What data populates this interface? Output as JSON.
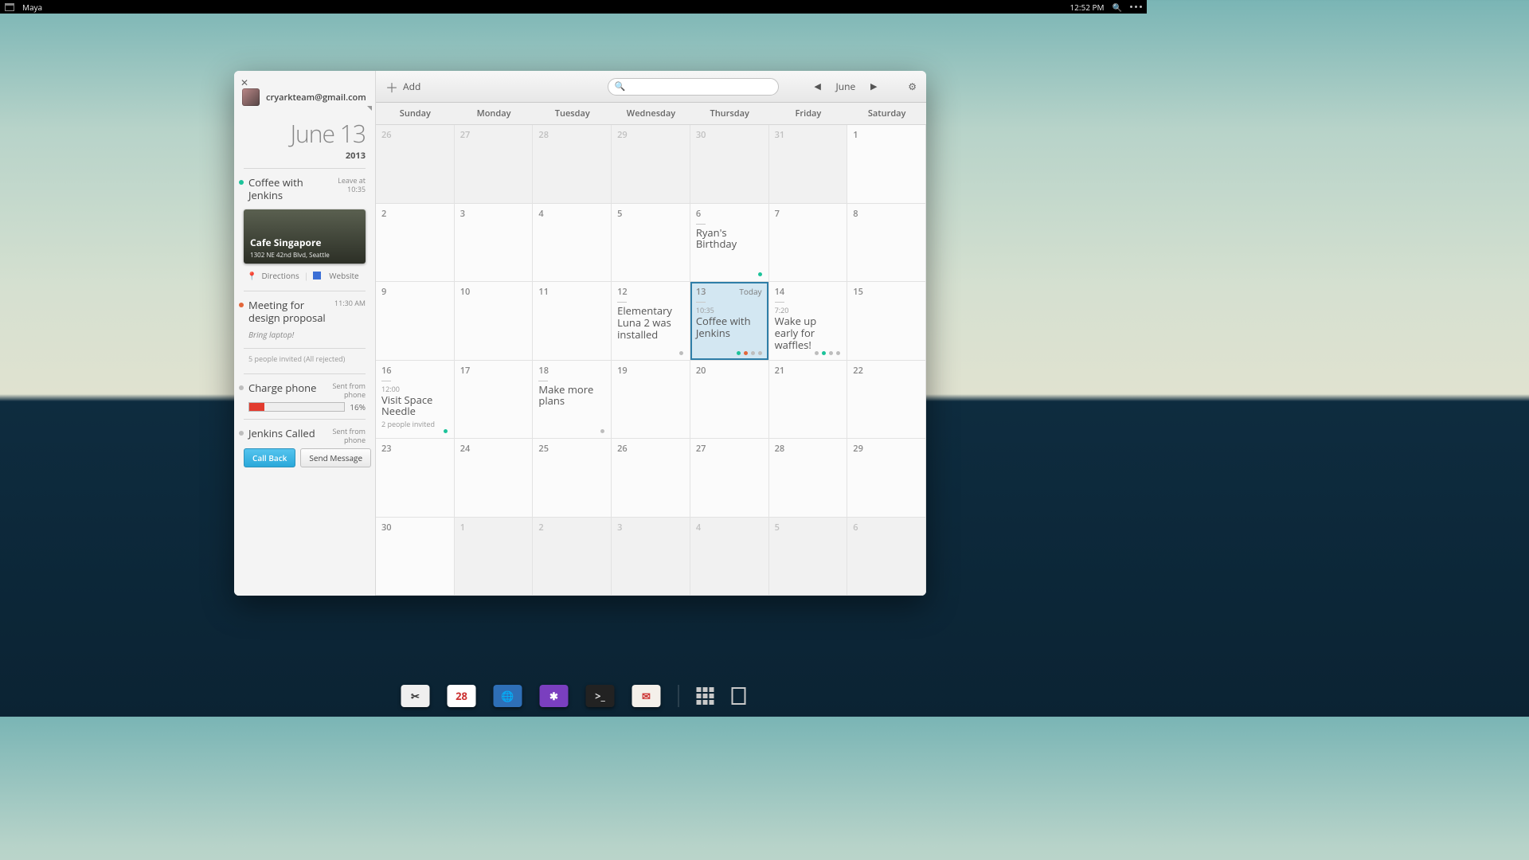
{
  "topbar": {
    "app_name": "Maya",
    "clock": "12:52 PM"
  },
  "sidebar": {
    "email": "cryarkteam@gmail.com",
    "date_title": "June 13",
    "date_year": "2013",
    "items": [
      {
        "title": "Coffee with Jenkins",
        "meta1": "Leave at",
        "meta2": "10:35",
        "dot": "#1cc39a"
      },
      {
        "title": "Meeting for design proposal",
        "meta1": "11:30 AM",
        "meta2": "",
        "dot": "#e2663a",
        "note": "Bring laptop!",
        "sub": "5 people invited (All rejected)"
      },
      {
        "title": "Charge phone",
        "meta1": "Sent from",
        "meta2": "phone",
        "dot": "#bdbdbd",
        "progress": 16,
        "pct_label": "16%"
      },
      {
        "title": "Jenkins Called",
        "meta1": "Sent from",
        "meta2": "phone",
        "dot": "#bdbdbd"
      }
    ],
    "place": {
      "name": "Cafe Singapore",
      "address": "1302 NE 42nd Blvd, Seattle"
    },
    "place_links": {
      "directions": "Directions",
      "website": "Website"
    },
    "buttons": {
      "call_back": "Call Back",
      "send_message": "Send Message"
    }
  },
  "toolbar": {
    "add_label": "Add",
    "search_placeholder": "",
    "month_label": "June"
  },
  "day_headers": [
    "Sunday",
    "Monday",
    "Tuesday",
    "Wednesday",
    "Thursday",
    "Friday",
    "Saturday"
  ],
  "weeks": [
    [
      {
        "n": "26",
        "dim": true
      },
      {
        "n": "27",
        "dim": true
      },
      {
        "n": "28",
        "dim": true
      },
      {
        "n": "29",
        "dim": true
      },
      {
        "n": "30",
        "dim": true
      },
      {
        "n": "31",
        "dim": true
      },
      {
        "n": "1"
      }
    ],
    [
      {
        "n": "2"
      },
      {
        "n": "3"
      },
      {
        "n": "4"
      },
      {
        "n": "5"
      },
      {
        "n": "6",
        "ev": {
          "title": "Ryan's Birthday"
        },
        "dots": [
          "#1cc39a"
        ]
      },
      {
        "n": "7"
      },
      {
        "n": "8"
      }
    ],
    [
      {
        "n": "9"
      },
      {
        "n": "10"
      },
      {
        "n": "11"
      },
      {
        "n": "12",
        "ev": {
          "title": "Elementary Luna 2 was installed"
        },
        "dots": [
          "#bdbdbd"
        ]
      },
      {
        "n": "13",
        "today": true,
        "today_label": "Today",
        "ev": {
          "time": "10:35",
          "title": "Coffee with Jenkins"
        },
        "dots": [
          "#1cc39a",
          "#e2663a",
          "#bdbdbd",
          "#bdbdbd"
        ]
      },
      {
        "n": "14",
        "ev": {
          "time": "7:20",
          "title": "Wake up early for waffles!"
        },
        "dots": [
          "#bdbdbd",
          "#1cc39a",
          "#bdbdbd",
          "#bdbdbd"
        ]
      },
      {
        "n": "15"
      }
    ],
    [
      {
        "n": "16",
        "ev": {
          "time": "12:00",
          "title": "Visit Space Needle",
          "sub": "2 people invited"
        },
        "dots": [
          "#1cc39a"
        ]
      },
      {
        "n": "17"
      },
      {
        "n": "18",
        "ev": {
          "title": "Make more plans"
        },
        "dots": [
          "#bdbdbd"
        ]
      },
      {
        "n": "19"
      },
      {
        "n": "20"
      },
      {
        "n": "21"
      },
      {
        "n": "22"
      }
    ],
    [
      {
        "n": "23"
      },
      {
        "n": "24"
      },
      {
        "n": "25"
      },
      {
        "n": "26"
      },
      {
        "n": "27"
      },
      {
        "n": "28"
      },
      {
        "n": "29"
      }
    ],
    [
      {
        "n": "30"
      },
      {
        "n": "1",
        "dim": true
      },
      {
        "n": "2",
        "dim": true
      },
      {
        "n": "3",
        "dim": true
      },
      {
        "n": "4",
        "dim": true
      },
      {
        "n": "5",
        "dim": true
      },
      {
        "n": "6",
        "dim": true
      }
    ]
  ],
  "dock": {
    "apps": [
      {
        "name": "tools",
        "bg": "#efefef",
        "fg": "#333",
        "glyph": "✂"
      },
      {
        "name": "calendar",
        "bg": "#ffffff",
        "fg": "#c33",
        "glyph": "28",
        "running": true
      },
      {
        "name": "browser",
        "bg": "#2e6fb7",
        "fg": "#fff",
        "glyph": "🌐",
        "running": true
      },
      {
        "name": "settings",
        "bg": "#7a3fbf",
        "fg": "#fff",
        "glyph": "✱",
        "running": true
      },
      {
        "name": "terminal",
        "bg": "#222",
        "fg": "#ddd",
        "glyph": ">_"
      },
      {
        "name": "mail",
        "bg": "#f4f0ea",
        "fg": "#c33",
        "glyph": "✉"
      }
    ]
  }
}
